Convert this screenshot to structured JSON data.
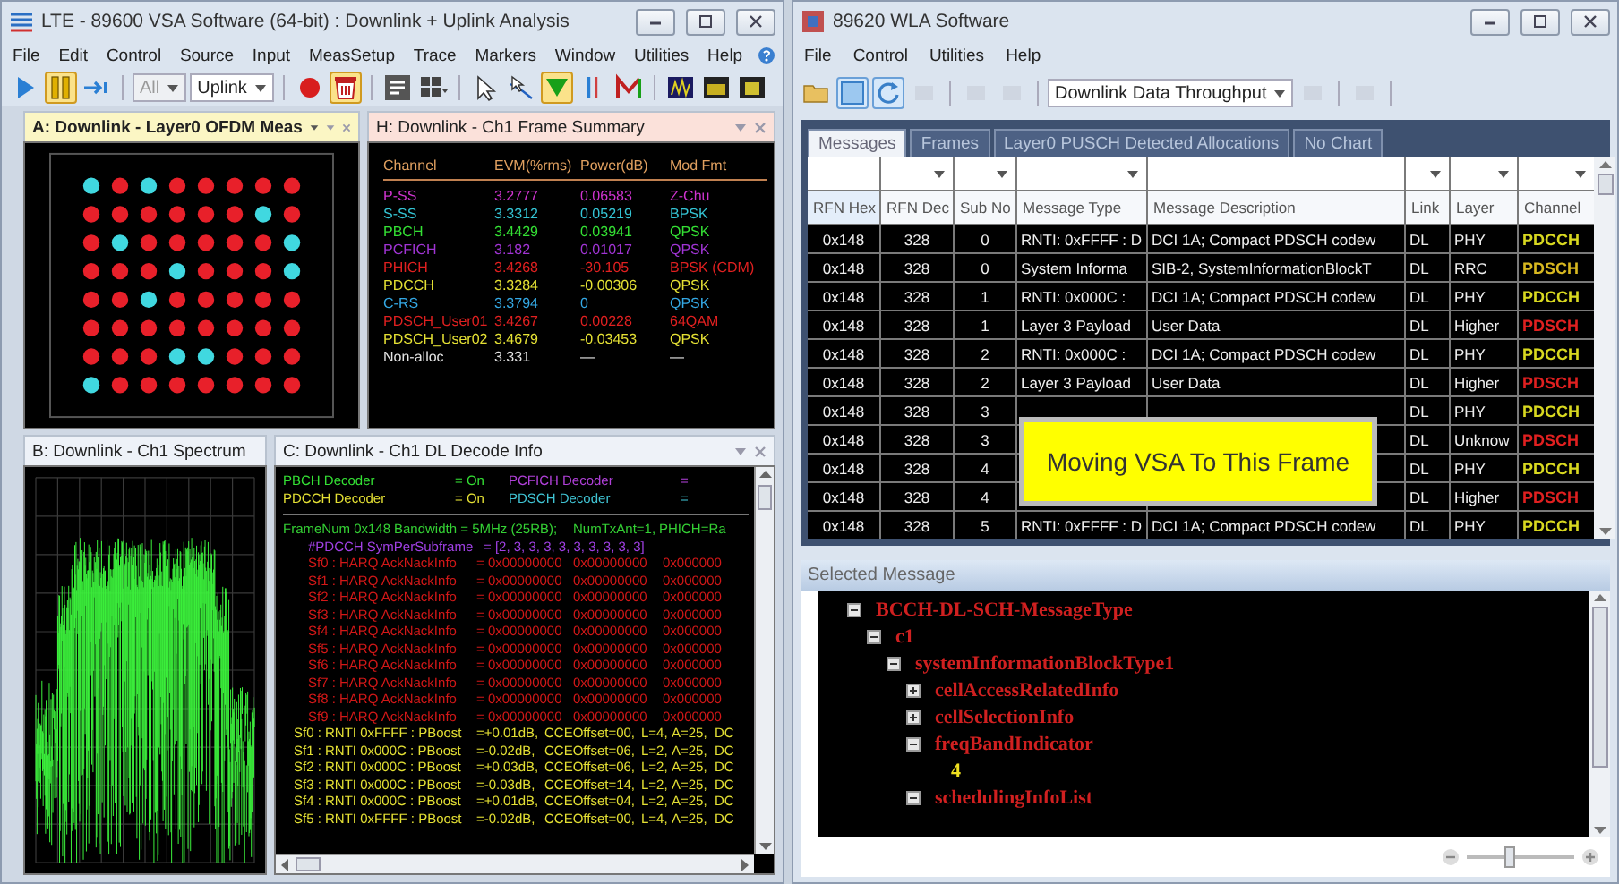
{
  "vsa_window": {
    "title": "LTE - 89600 VSA Software (64-bit) : Downlink + Uplink Analysis",
    "menu": [
      "File",
      "Edit",
      "Control",
      "Source",
      "Input",
      "MeasSetup",
      "Trace",
      "Markers",
      "Window",
      "Utilities",
      "Help"
    ],
    "toolbar": [
      {
        "kind": "play",
        "pressed": false
      },
      {
        "kind": "pause",
        "pressed": true
      },
      {
        "kind": "step",
        "pressed": false
      },
      {
        "kind": "separator"
      },
      {
        "kind": "dropdown",
        "label": "All",
        "disabled": true
      },
      {
        "kind": "dropdown",
        "label": "Uplink",
        "disabled": false
      },
      {
        "kind": "separator"
      },
      {
        "kind": "record",
        "pressed": false
      },
      {
        "kind": "preset",
        "pressed": true
      },
      {
        "kind": "separator"
      },
      {
        "kind": "annotate",
        "pressed": false
      },
      {
        "kind": "layout",
        "pressed": false
      },
      {
        "kind": "separator"
      },
      {
        "kind": "pointer",
        "pressed": false
      },
      {
        "kind": "trace_pointer",
        "pressed": false
      },
      {
        "kind": "peak",
        "pressed": true
      },
      {
        "kind": "bars",
        "pressed": false
      },
      {
        "kind": "marker",
        "pressed": false
      },
      {
        "kind": "separator"
      },
      {
        "kind": "chart_a",
        "pressed": false
      },
      {
        "kind": "chart_b",
        "pressed": false
      },
      {
        "kind": "chart_c",
        "pressed": false
      }
    ],
    "panels": [
      {
        "kind": "constellation",
        "title": "A: Downlink - Layer0 OFDM Meas",
        "color": "#fbf6c4",
        "selected": true
      },
      {
        "kind": "frame_summary",
        "title": "H: Downlink - Ch1 Frame Summary",
        "color": "#fbe1da",
        "selected": false,
        "columns": [
          "Channel",
          "EVM(%rms)",
          "Power(dB)",
          "Mod Fmt"
        ],
        "rows": [
          {
            "channel": "P-SS",
            "evm": "3.2777",
            "power": "0.06583",
            "mod": "Z-Chu",
            "color": "#d034d0"
          },
          {
            "channel": "S-SS",
            "evm": "3.3312",
            "power": "0.05219",
            "mod": "BPSK",
            "color": "#34c4d4"
          },
          {
            "channel": "PBCH",
            "evm": "3.4429",
            "power": "0.03941",
            "mod": "QPSK",
            "color": "#34e034"
          },
          {
            "channel": "PCFICH",
            "evm": "3.182",
            "power": "0.01017",
            "mod": "QPSK",
            "color": "#a034d4"
          },
          {
            "channel": "PHICH",
            "evm": "3.4268",
            "power": "-30.105",
            "mod": "BPSK (CDM)",
            "color": "#e02020"
          },
          {
            "channel": "PDCCH",
            "evm": "3.3284",
            "power": "-0.00306",
            "mod": "QPSK",
            "color": "#e4e034"
          },
          {
            "channel": "C-RS",
            "evm": "3.3794",
            "power": "0",
            "mod": "QPSK",
            "color": "#34a8e4"
          },
          {
            "channel": "PDSCH_User01",
            "evm": "3.4267",
            "power": "0.00228",
            "mod": "64QAM",
            "color": "#e02020"
          },
          {
            "channel": "PDSCH_User02",
            "evm": "3.4679",
            "power": "-0.03453",
            "mod": "QPSK",
            "color": "#e4e034"
          },
          {
            "channel": "Non-alloc",
            "evm": "3.331",
            "power": "—",
            "mod": "—",
            "color": "#e4e4e4"
          }
        ]
      },
      {
        "kind": "spectrum",
        "title": "B: Downlink - Ch1 Spectrum",
        "color": "#eef2f8",
        "selected": false
      },
      {
        "kind": "decode_info",
        "title": "C: Downlink - Ch1 DL Decode Info",
        "color": "#eef2f8",
        "selected": false,
        "lines": [
          {
            "kind": "decoder",
            "items": [
              {
                "name": "PBCH Decoder",
                "value": "= On",
                "color": "#34e034"
              },
              {
                "name": "PCFICH Decoder",
                "value": "=",
                "color": "#b040d8"
              }
            ]
          },
          {
            "kind": "decoder",
            "items": [
              {
                "name": "PDCCH Decoder",
                "value": "= On",
                "color": "#e4e034"
              },
              {
                "name": "PDSCH Decoder",
                "value": "=",
                "color": "#40c4d4"
              }
            ]
          },
          {
            "kind": "frame",
            "color": "#34d034",
            "parts": [
              "FrameNum 0x148",
              "Bandwidth = 5MHz (25RB);",
              "NumTxAnt=1,",
              "PHICH=Ra"
            ]
          },
          {
            "kind": "symbols",
            "color": "#a040e4",
            "parts": [
              "#PDCCH SymPerSubframe",
              "= [2, 3, 3, 3, 3, 3, 3, 3, 3, 3]"
            ]
          },
          {
            "kind": "harq",
            "color": "#d41818",
            "parts": [
              "Sf0 : HARQ AckNackInfo",
              "= 0x00000000",
              "0x00000000",
              "0x000000"
            ]
          },
          {
            "kind": "harq",
            "color": "#d41818",
            "parts": [
              "Sf1 : HARQ AckNackInfo",
              "= 0x00000000",
              "0x00000000",
              "0x000000"
            ]
          },
          {
            "kind": "harq",
            "color": "#d41818",
            "parts": [
              "Sf2 : HARQ AckNackInfo",
              "= 0x00000000",
              "0x00000000",
              "0x000000"
            ]
          },
          {
            "kind": "harq",
            "color": "#d41818",
            "parts": [
              "Sf3 : HARQ AckNackInfo",
              "= 0x00000000",
              "0x00000000",
              "0x000000"
            ]
          },
          {
            "kind": "harq",
            "color": "#d41818",
            "parts": [
              "Sf4 : HARQ AckNackInfo",
              "= 0x00000000",
              "0x00000000",
              "0x000000"
            ]
          },
          {
            "kind": "harq",
            "color": "#d41818",
            "parts": [
              "Sf5 : HARQ AckNackInfo",
              "= 0x00000000",
              "0x00000000",
              "0x000000"
            ]
          },
          {
            "kind": "harq",
            "color": "#d41818",
            "parts": [
              "Sf6 : HARQ AckNackInfo",
              "= 0x00000000",
              "0x00000000",
              "0x000000"
            ]
          },
          {
            "kind": "harq",
            "color": "#d41818",
            "parts": [
              "Sf7 : HARQ AckNackInfo",
              "= 0x00000000",
              "0x00000000",
              "0x000000"
            ]
          },
          {
            "kind": "harq",
            "color": "#d41818",
            "parts": [
              "Sf8 : HARQ AckNackInfo",
              "= 0x00000000",
              "0x00000000",
              "0x000000"
            ]
          },
          {
            "kind": "harq",
            "color": "#d41818",
            "parts": [
              "Sf9 : HARQ AckNackInfo",
              "= 0x00000000",
              "0x00000000",
              "0x000000"
            ]
          },
          {
            "kind": "dci",
            "color": "#e4e034",
            "parts": [
              "Sf0 : RNTI 0xFFFF : PBoost",
              "=+0.01dB,",
              "CCEOffset=00,",
              "L=4,",
              "A=25,",
              "DC"
            ]
          },
          {
            "kind": "dci",
            "color": "#e4e034",
            "parts": [
              "Sf1 : RNTI 0x000C : PBoost",
              "=-0.02dB,",
              "CCEOffset=06,",
              "L=2,",
              "A=25,",
              "DC"
            ]
          },
          {
            "kind": "dci",
            "color": "#e4e034",
            "parts": [
              "Sf2 : RNTI 0x000C : PBoost",
              "=+0.03dB,",
              "CCEOffset=06,",
              "L=2,",
              "A=25,",
              "DC"
            ]
          },
          {
            "kind": "dci",
            "color": "#e4e034",
            "parts": [
              "Sf3 : RNTI 0x000C : PBoost",
              "=-0.03dB,",
              "CCEOffset=14,",
              "L=2,",
              "A=25,",
              "DC"
            ]
          },
          {
            "kind": "dci",
            "color": "#e4e034",
            "parts": [
              "Sf4 : RNTI 0x000C : PBoost",
              "=+0.01dB,",
              "CCEOffset=04,",
              "L=2,",
              "A=25,",
              "DC"
            ]
          },
          {
            "kind": "dci",
            "color": "#e4e034",
            "parts": [
              "Sf5 : RNTI 0xFFFF : PBoost",
              "=-0.02dB,",
              "CCEOffset=00,",
              "L=4,",
              "A=25,",
              "DC"
            ]
          }
        ]
      }
    ]
  },
  "wla_window": {
    "title": "89620 WLA Software",
    "menu": [
      "File",
      "Control",
      "Utilities",
      "Help"
    ],
    "toolbar": [
      {
        "kind": "open",
        "pressed": false
      },
      {
        "kind": "view",
        "pressed": true
      },
      {
        "kind": "refresh",
        "pressed": true
      },
      {
        "kind": "blank",
        "disabled": true
      },
      {
        "kind": "separator"
      },
      {
        "kind": "blank",
        "disabled": true
      },
      {
        "kind": "blank",
        "disabled": true
      },
      {
        "kind": "separator"
      },
      {
        "kind": "dropdown",
        "label": "Downlink Data Throughput",
        "disabled": false
      },
      {
        "kind": "blank",
        "disabled": true
      },
      {
        "kind": "separator"
      },
      {
        "kind": "blank",
        "disabled": true
      },
      {
        "kind": "separator"
      }
    ],
    "tabs": [
      {
        "label": "Messages",
        "selected": true
      },
      {
        "label": "Frames",
        "selected": false
      },
      {
        "label": "Layer0 PUSCH Detected Allocations",
        "selected": false
      },
      {
        "label": "No Chart",
        "selected": false
      }
    ],
    "table": {
      "columns": [
        "RFN Hex",
        "RFN Dec",
        "Sub No",
        "Message Type",
        "Message Description",
        "Link",
        "Layer",
        "Channel"
      ],
      "rows": [
        {
          "rfn_hex": "0x148",
          "rfn_dec": "328",
          "sub_no": "0",
          "message_type": "RNTI: 0xFFFF : D",
          "message_description": "DCI 1A; Compact PDSCH codew",
          "link": "DL",
          "layer": "PHY",
          "channel": "PDCCH",
          "color": "#d8d820"
        },
        {
          "rfn_hex": "0x148",
          "rfn_dec": "328",
          "sub_no": "0",
          "message_type": "System Informa",
          "message_description": "SIB-2, SystemInformationBlockT",
          "link": "DL",
          "layer": "RRC",
          "channel": "PDSCH",
          "color": "#d8b820"
        },
        {
          "rfn_hex": "0x148",
          "rfn_dec": "328",
          "sub_no": "1",
          "message_type": "RNTI: 0x000C :",
          "message_description": "DCI 1A; Compact PDSCH codew",
          "link": "DL",
          "layer": "PHY",
          "channel": "PDCCH",
          "color": "#d8d820"
        },
        {
          "rfn_hex": "0x148",
          "rfn_dec": "328",
          "sub_no": "1",
          "message_type": "Layer 3 Payload",
          "message_description": "User Data",
          "link": "DL",
          "layer": "Higher",
          "channel": "PDSCH",
          "color": "#e02020"
        },
        {
          "rfn_hex": "0x148",
          "rfn_dec": "328",
          "sub_no": "2",
          "message_type": "RNTI: 0x000C :",
          "message_description": "DCI 1A; Compact PDSCH codew",
          "link": "DL",
          "layer": "PHY",
          "channel": "PDCCH",
          "color": "#d8d820"
        },
        {
          "rfn_hex": "0x148",
          "rfn_dec": "328",
          "sub_no": "2",
          "message_type": "Layer 3 Payload",
          "message_description": "User Data",
          "link": "DL",
          "layer": "Higher",
          "channel": "PDSCH",
          "color": "#e02020"
        },
        {
          "rfn_hex": "0x148",
          "rfn_dec": "328",
          "sub_no": "3",
          "link": "DL",
          "layer": "PHY",
          "channel": "PDCCH",
          "color": "#d8d820"
        },
        {
          "rfn_hex": "0x148",
          "rfn_dec": "328",
          "sub_no": "3",
          "link": "DL",
          "layer": "Unknow",
          "channel": "PDSCH",
          "color": "#e02020"
        },
        {
          "rfn_hex": "0x148",
          "rfn_dec": "328",
          "sub_no": "4",
          "link": "DL",
          "layer": "PHY",
          "channel": "PDCCH",
          "color": "#d8d820"
        },
        {
          "rfn_hex": "0x148",
          "rfn_dec": "328",
          "sub_no": "4",
          "link": "DL",
          "layer": "Higher",
          "channel": "PDSCH",
          "color": "#e02020"
        },
        {
          "rfn_hex": "0x148",
          "rfn_dec": "328",
          "sub_no": "5",
          "message_type": "RNTI: 0xFFFF : D",
          "message_description": "DCI 1A; Compact PDSCH codew",
          "link": "DL",
          "layer": "PHY",
          "channel": "PDCCH",
          "color": "#d8d820"
        }
      ]
    },
    "overlay": {
      "text": "Moving VSA To This Frame"
    },
    "selected_message": {
      "title": "Selected Message",
      "tree": [
        {
          "label": "BCCH-DL-SCH-MessageType",
          "expanded": true,
          "children": [
            {
              "label": "c1",
              "expanded": true,
              "children": [
                {
                  "label": "systemInformationBlockType1",
                  "expanded": true,
                  "children": [
                    {
                      "label": "cellAccessRelatedInfo",
                      "expanded": false
                    },
                    {
                      "label": "cellSelectionInfo",
                      "expanded": false
                    },
                    {
                      "label": "freqBandIndicator",
                      "expanded": true,
                      "children": [
                        {
                          "value": "4"
                        }
                      ]
                    },
                    {
                      "label": "schedulingInfoList",
                      "expanded": true
                    }
                  ]
                }
              ]
            }
          ]
        }
      ],
      "zoom": {
        "level": 0.4
      }
    }
  }
}
